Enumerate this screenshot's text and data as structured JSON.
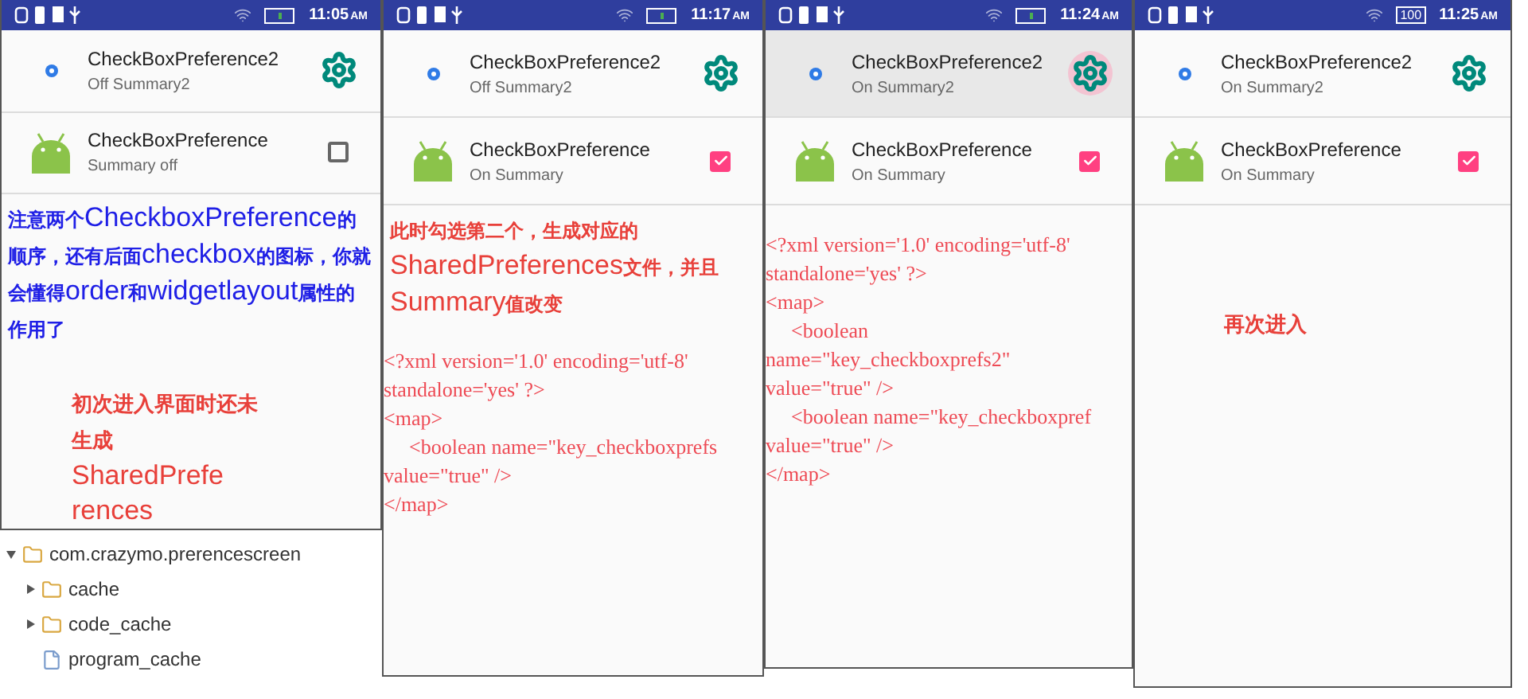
{
  "panels": [
    {
      "status_bar": {
        "time": "11:05",
        "meridiem": "AM"
      },
      "preferences": [
        {
          "title": "CheckBoxPreference2",
          "summary": "Off Summary2",
          "kind": "gear",
          "pressed": false
        },
        {
          "title": "CheckBoxPreference",
          "summary": "Summary off",
          "kind": "checkbox",
          "checked": false,
          "pressed": false
        }
      ],
      "notes": [
        {
          "kind": "annotation",
          "color": "#1f1fe6",
          "text": "**注意两个**CheckboxPreference**的顺序，还有后面**checkbox**的图标，你就会懂得**order**和**widgetlayout**属性的作用了**"
        },
        {
          "kind": "annotation_indented",
          "color": "#e8403a",
          "text": "**初次进入界面时还未生成**SharedPrefe rences"
        }
      ],
      "file_tree": [
        {
          "label": "com.crazymo.prerencescreen",
          "kind": "folder",
          "expanded": true,
          "children": [
            {
              "label": "cache",
              "kind": "folder",
              "expanded": false
            },
            {
              "label": "code_cache",
              "kind": "folder",
              "expanded": false
            },
            {
              "label": "program_cache",
              "kind": "file"
            }
          ]
        }
      ]
    },
    {
      "status_bar": {
        "time": "11:17",
        "meridiem": "AM"
      },
      "preferences": [
        {
          "title": "CheckBoxPreference2",
          "summary": "Off Summary2",
          "kind": "gear",
          "pressed": false
        },
        {
          "title": "CheckBoxPreference",
          "summary": "On Summary",
          "kind": "checkbox",
          "checked": true,
          "pressed": false
        }
      ],
      "notes": [
        {
          "kind": "annotation",
          "color": "#e8403a",
          "text": "**此时勾选第二个，生成对应的**SharedPreferences**文件，并且**Summary**值改变**"
        },
        {
          "kind": "xml",
          "color": "#ee4b55",
          "lines": [
            {
              "text": "<?xml version='1.0' encoding='utf-8'",
              "indented": false
            },
            {
              "text": "standalone='yes' ?>",
              "indented": false
            },
            {
              "text": "<map>",
              "indented": false
            },
            {
              "text": "<boolean name=\"key_checkboxprefs",
              "indented": true
            },
            {
              "text": "value=\"true\" />",
              "indented": false
            },
            {
              "text": "</map>",
              "indented": false
            }
          ]
        }
      ]
    },
    {
      "status_bar": {
        "time": "11:24",
        "meridiem": "AM"
      },
      "preferences": [
        {
          "title": "CheckBoxPreference2",
          "summary": "On Summary2",
          "kind": "gear",
          "pressed": true
        },
        {
          "title": "CheckBoxPreference",
          "summary": "On Summary",
          "kind": "checkbox",
          "checked": true,
          "pressed": false
        }
      ],
      "notes": [
        {
          "kind": "xml",
          "color": "#ee4b55",
          "lines": [
            {
              "text": "<?xml version='1.0' encoding='utf-8'",
              "indented": false
            },
            {
              "text": "standalone='yes' ?>",
              "indented": false
            },
            {
              "text": "<map>",
              "indented": false
            },
            {
              "text": "<boolean",
              "indented": true
            },
            {
              "text": "name=\"key_checkboxprefs2\"",
              "indented": false
            },
            {
              "text": "value=\"true\" />",
              "indented": false
            },
            {
              "text": "<boolean name=\"key_checkboxpref",
              "indented": true
            },
            {
              "text": "value=\"true\" />",
              "indented": false
            },
            {
              "text": "</map>",
              "indented": false
            }
          ]
        }
      ]
    },
    {
      "status_bar": {
        "time": "11:25",
        "meridiem": "AM",
        "battery_label": "100"
      },
      "preferences": [
        {
          "title": "CheckBoxPreference2",
          "summary": "On Summary2",
          "kind": "gear",
          "pressed": false
        },
        {
          "title": "CheckBoxPreference",
          "summary": "On Summary",
          "kind": "checkbox",
          "checked": true,
          "pressed": false
        }
      ],
      "notes": [
        {
          "kind": "annotation_centered",
          "color": "#e8403a",
          "text": "**再次进入**"
        }
      ]
    }
  ]
}
